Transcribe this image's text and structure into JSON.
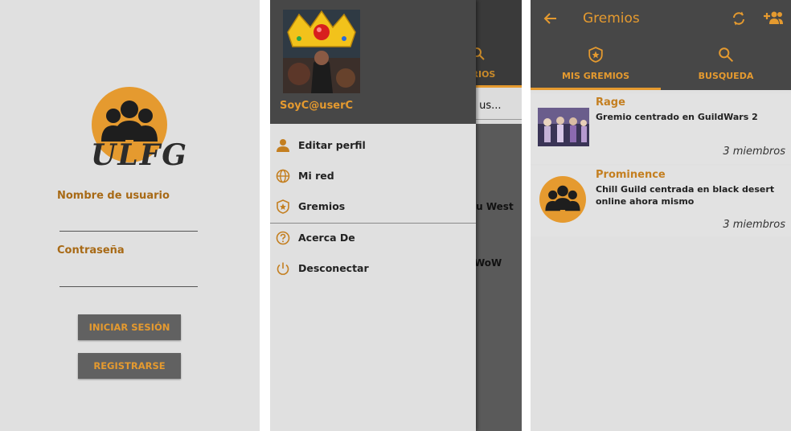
{
  "login": {
    "logo_text": "ULFG",
    "username_label": "Nombre de usuario",
    "password_label": "Contraseña",
    "login_button": "INICIAR SESIÓN",
    "register_button": "REGISTRARSE"
  },
  "drawer": {
    "username": "SoyC@userC",
    "items": [
      {
        "label": "Editar perfil",
        "icon": "person-icon"
      },
      {
        "label": "Mi red",
        "icon": "globe-icon"
      },
      {
        "label": "Gremios",
        "icon": "shield-star-icon"
      },
      {
        "label": "Acerca De",
        "icon": "help-circle-icon"
      },
      {
        "label": "Desconectar",
        "icon": "power-icon"
      }
    ],
    "underlay": {
      "tab_fragment": "ARIOS",
      "text_1": "e us...",
      "text_2": "eu West",
      "text_3": "WoW"
    }
  },
  "guilds": {
    "title": "Gremios",
    "tabs": [
      {
        "label": "MIS GREMIOS",
        "icon": "shield-star-icon",
        "selected": true
      },
      {
        "label": "BUSQUEDA",
        "icon": "search-icon",
        "selected": false
      }
    ],
    "list": [
      {
        "name": "Rage",
        "description": "Gremio centrado en GuildWars 2",
        "members": "3 miembros"
      },
      {
        "name": "Prominence",
        "description": "Chill Guild centrada en black desert online ahora mismo",
        "members": "3 miembros"
      }
    ]
  },
  "colors": {
    "accent": "#e59a2f",
    "dark": "#474747",
    "background": "#e0e0e0"
  }
}
